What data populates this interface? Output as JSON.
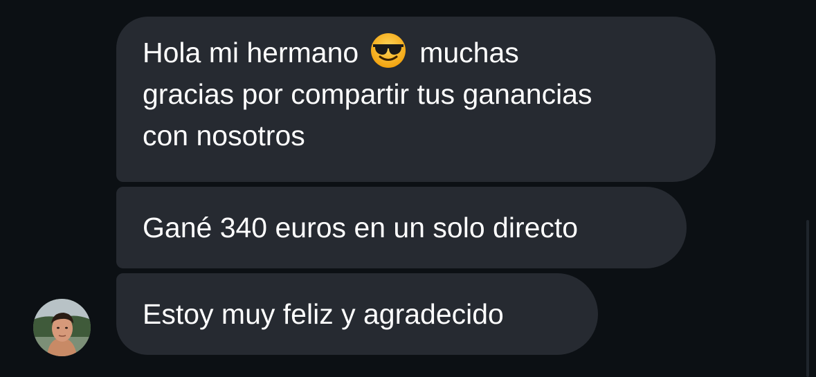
{
  "messages": [
    {
      "lines": [
        "Hola mi hermano",
        "muchas",
        "gracias por compartir tus ganancias",
        "con nosotros"
      ],
      "emoji": "smiling-face-with-sunglasses-icon"
    },
    {
      "text": "Gané 340 euros en un solo directo"
    },
    {
      "text": "Estoy muy feliz y agradecido"
    }
  ],
  "colors": {
    "background": "#0c1014",
    "bubble": "#262a31",
    "text": "#ffffff"
  }
}
